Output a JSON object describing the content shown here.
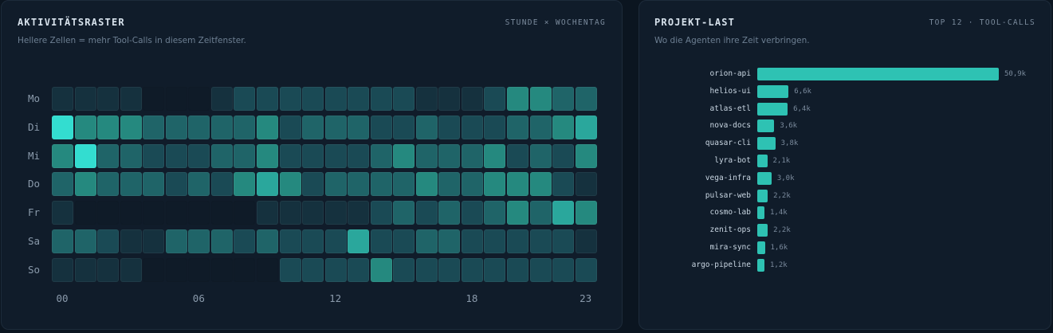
{
  "heatmap": {
    "title": "AKTIVITÄTSRASTER",
    "tag": "STUNDE × WOCHENTAG",
    "subtitle": "Hellere Zellen = mehr Tool-Calls in diesem Zeitfenster.",
    "hour_labels": [
      "00",
      "06",
      "12",
      "18",
      "23"
    ],
    "hour_label_positions": [
      0,
      6,
      12,
      18,
      23
    ],
    "days": [
      {
        "label": "Mo",
        "levels": [
          1,
          1,
          1,
          1,
          0,
          0,
          0,
          1,
          2,
          2,
          2,
          2,
          2,
          2,
          2,
          2,
          1,
          1,
          1,
          2,
          4,
          4,
          3,
          3
        ]
      },
      {
        "label": "Di",
        "levels": [
          6,
          4,
          4,
          4,
          3,
          3,
          3,
          3,
          3,
          4,
          2,
          3,
          3,
          3,
          2,
          2,
          3,
          2,
          2,
          2,
          3,
          3,
          4,
          5
        ]
      },
      {
        "label": "Mi",
        "levels": [
          4,
          6,
          3,
          3,
          2,
          2,
          2,
          3,
          3,
          4,
          2,
          2,
          2,
          2,
          3,
          4,
          3,
          3,
          3,
          4,
          2,
          3,
          2,
          4
        ]
      },
      {
        "label": "Do",
        "levels": [
          3,
          4,
          3,
          3,
          3,
          2,
          3,
          2,
          4,
          5,
          4,
          2,
          3,
          3,
          3,
          3,
          4,
          3,
          3,
          4,
          4,
          4,
          2,
          1
        ]
      },
      {
        "label": "Fr",
        "levels": [
          1,
          0,
          0,
          0,
          0,
          0,
          0,
          0,
          0,
          1,
          1,
          1,
          1,
          1,
          2,
          3,
          2,
          3,
          2,
          3,
          4,
          3,
          5,
          4
        ]
      },
      {
        "label": "Sa",
        "levels": [
          3,
          3,
          2,
          1,
          1,
          3,
          3,
          3,
          2,
          3,
          2,
          2,
          2,
          5,
          2,
          2,
          3,
          3,
          2,
          2,
          2,
          2,
          2,
          1
        ]
      },
      {
        "label": "So",
        "levels": [
          1,
          1,
          1,
          1,
          0,
          0,
          0,
          0,
          0,
          0,
          2,
          2,
          2,
          2,
          4,
          2,
          2,
          2,
          2,
          2,
          2,
          2,
          2,
          2
        ]
      }
    ],
    "colors": [
      "#0f1b28",
      "#15313e",
      "#1a4a55",
      "#1f6468",
      "#25897f",
      "#2aa79c",
      "#33ddd0"
    ]
  },
  "projects": {
    "title": "PROJEKT-LAST",
    "tag": "TOP 12 · TOOL-CALLS",
    "subtitle": "Wo die Agenten ihre Zeit verbringen.",
    "max_value": 50.9,
    "bar_color": "#2ec2b3",
    "items": [
      {
        "name": "orion-api",
        "value": 50.9,
        "display": "50,9k"
      },
      {
        "name": "helios-ui",
        "value": 6.6,
        "display": "6,6k"
      },
      {
        "name": "atlas-etl",
        "value": 6.4,
        "display": "6,4k"
      },
      {
        "name": "nova-docs",
        "value": 3.6,
        "display": "3,6k"
      },
      {
        "name": "quasar-cli",
        "value": 3.8,
        "display": "3,8k"
      },
      {
        "name": "lyra-bot",
        "value": 2.1,
        "display": "2,1k"
      },
      {
        "name": "vega-infra",
        "value": 3.0,
        "display": "3,0k"
      },
      {
        "name": "pulsar-web",
        "value": 2.2,
        "display": "2,2k"
      },
      {
        "name": "cosmo-lab",
        "value": 1.4,
        "display": "1,4k"
      },
      {
        "name": "zenit-ops",
        "value": 2.2,
        "display": "2,2k"
      },
      {
        "name": "mira-sync",
        "value": 1.6,
        "display": "1,6k"
      },
      {
        "name": "argo-pipeline",
        "value": 1.2,
        "display": "1,2k"
      }
    ]
  }
}
